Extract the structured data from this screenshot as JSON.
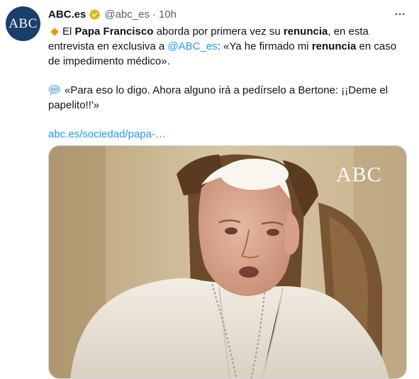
{
  "tweet": {
    "avatar_text": "ABC",
    "display_name": "ABC.es",
    "handle": "@abc_es",
    "separator": "·",
    "time": "10h",
    "verified_icon": "verified-badge-gold",
    "more_icon": "more-horizontal-icon",
    "body": {
      "p1": {
        "prefix_icon": "orange-diamond",
        "t1": "El ",
        "b1": "Papa Francisco",
        "t2": " aborda por primera vez su ",
        "b2": "renuncia",
        "t3": ", en esta entrevista en exclusiva a ",
        "mention": "@ABC_es",
        "t4": ": «Ya he firmado mi ",
        "b3": "renuncia",
        "t5": " en caso de impedimento médico»."
      },
      "p2": {
        "prefix_icon": "speech-balloon",
        "text": "«Para eso lo digo. Ahora alguno irá a pedírselo a Bertone: ¡¡Deme el papelito!!'»"
      },
      "link": "abc.es/sociedad/papa-…"
    },
    "media": {
      "watermark": "ABC",
      "description_icon": "video-frame-pope"
    }
  },
  "colors": {
    "text": "#0f1419",
    "secondary": "#536471",
    "link": "#1d9bf0",
    "verified": "#e2b719",
    "avatar_bg": "#1b3f6b"
  }
}
